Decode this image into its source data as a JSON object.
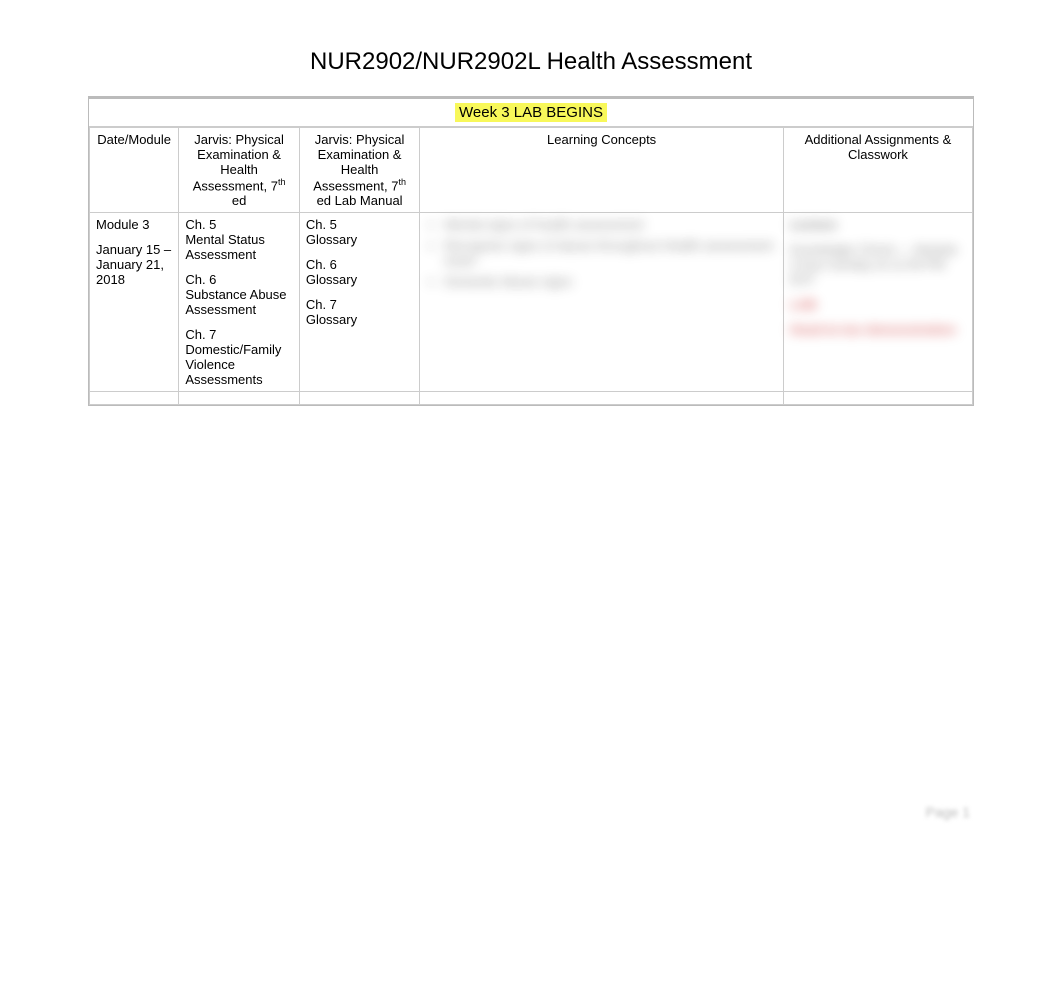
{
  "title": "NUR2902/NUR2902L Health Assessment",
  "banner": "Week 3 LAB BEGINS",
  "page_number": "Page 1",
  "headers": {
    "date": "Date/Module",
    "textbook_prefix": "Jarvis: Physical Examination & Health Assessment, 7",
    "textbook_sup": "th",
    "textbook_suffix": " ed",
    "lab_prefix": "Jarvis: Physical Examination & Health Assessment, 7",
    "lab_sup": "th",
    "lab_suffix": " ed Lab Manual",
    "learning": "Learning Concepts",
    "assignments": "Additional Assignments & Classwork"
  },
  "row": {
    "module": "Module 3",
    "date_range": "January 15 – January 21, 2018",
    "textbook": {
      "ch5_a": "Ch. 5",
      "ch5_b": "Mental Status Assessment",
      "ch6_a": "Ch. 6",
      "ch6_b": "Substance Abuse Assessment",
      "ch7_a": "Ch. 7",
      "ch7_b": "Domestic/Family Violence Assessments"
    },
    "lab": {
      "ch5_a": "Ch. 5",
      "ch5_b": "Glossary",
      "ch6_a": "Ch. 6",
      "ch6_b": "Glossary",
      "ch7_a": "Ch. 7",
      "ch7_b": "Glossary"
    },
    "learning": {
      "b1": "Mental signs of health assessment",
      "b2": "Recognize signs of abuse throughout Health assessment exam",
      "b3": "Domestic Abuse signs"
    },
    "assign": {
      "l1": "Lecture",
      "l2": "Knowledge Check — Module 3 Due Sunday at 11:59 PM EST",
      "lab_hdr": "LAB",
      "lab1": "Head-to-toe demonstration"
    }
  }
}
